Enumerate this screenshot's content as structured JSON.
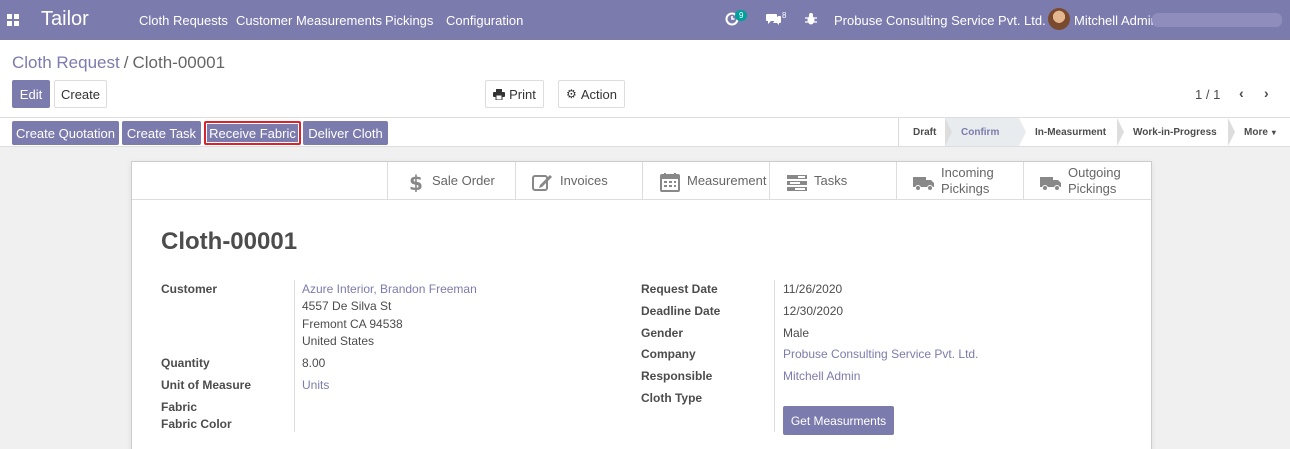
{
  "navbar": {
    "brand": "Tailor",
    "menu": [
      "Cloth Requests",
      "Customer Measurements",
      "Pickings",
      "Configuration"
    ],
    "activity_count": "9",
    "message_count": "8",
    "company": "Probuse Consulting Service Pvt. Ltd.",
    "user": "Mitchell Admin"
  },
  "breadcrumb": {
    "parent": "Cloth Request",
    "separator": "/",
    "current": "Cloth-00001"
  },
  "buttons": {
    "edit": "Edit",
    "create": "Create",
    "print": "Print",
    "action": "Action"
  },
  "pager": {
    "value": "1 / 1"
  },
  "statusbar": {
    "buttons": [
      "Create Quotation",
      "Create Task",
      "Receive Fabric",
      "Deliver Cloth"
    ],
    "highlighted": "Receive Fabric",
    "stages": [
      "Draft",
      "Confirm",
      "In-Measurment",
      "Work-in-Progress",
      "More"
    ],
    "active_stage": "Confirm"
  },
  "smart_buttons": [
    {
      "label": "Sale Order",
      "icon": "dollar-icon"
    },
    {
      "label": "Invoices",
      "icon": "edit-icon"
    },
    {
      "label": "Measurement",
      "icon": "calendar-icon"
    },
    {
      "label": "Tasks",
      "icon": "tasks-icon"
    },
    {
      "label_line1": "Incoming",
      "label_line2": "Pickings",
      "icon": "truck-icon"
    },
    {
      "label_line1": "Outgoing",
      "label_line2": "Pickings",
      "icon": "truck-icon"
    }
  ],
  "record": {
    "name": "Cloth-00001",
    "left": {
      "customer_label": "Customer",
      "customer_name": "Azure Interior, Brandon Freeman",
      "address_line1": "4557 De Silva St",
      "address_line2": "Fremont CA 94538",
      "address_line3": "United States",
      "quantity_label": "Quantity",
      "quantity": "8.00",
      "uom_label": "Unit of Measure",
      "uom": "Units",
      "fabric_label": "Fabric",
      "fabric_color_label": "Fabric Color"
    },
    "right": {
      "request_date_label": "Request Date",
      "request_date": "11/26/2020",
      "deadline_label": "Deadline Date",
      "deadline": "12/30/2020",
      "gender_label": "Gender",
      "gender": "Male",
      "company_label": "Company",
      "company": "Probuse Consulting Service Pvt. Ltd.",
      "responsible_label": "Responsible",
      "responsible": "Mitchell Admin",
      "cloth_type_label": "Cloth Type",
      "get_measurements": "Get Measurments"
    }
  },
  "colors": {
    "brand": "#7c7bad",
    "highlight_border": "#d9232d",
    "badge": "#00a09d"
  }
}
